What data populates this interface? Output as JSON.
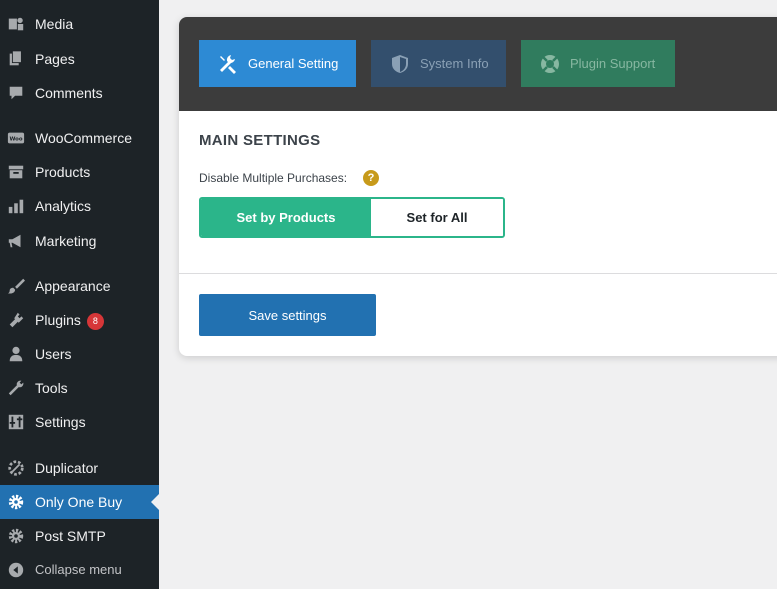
{
  "sidebar": {
    "items": [
      {
        "label": "Media",
        "icon": "media-icon"
      },
      {
        "label": "Pages",
        "icon": "pages-icon"
      },
      {
        "label": "Comments",
        "icon": "comments-icon"
      },
      {
        "label": "WooCommerce",
        "icon": "woocommerce-icon"
      },
      {
        "label": "Products",
        "icon": "products-icon"
      },
      {
        "label": "Analytics",
        "icon": "analytics-icon"
      },
      {
        "label": "Marketing",
        "icon": "megaphone-icon"
      },
      {
        "label": "Appearance",
        "icon": "paintbrush-icon"
      },
      {
        "label": "Plugins",
        "icon": "plugin-icon",
        "badge": "8"
      },
      {
        "label": "Users",
        "icon": "users-icon"
      },
      {
        "label": "Tools",
        "icon": "wrench-icon"
      },
      {
        "label": "Settings",
        "icon": "settings-icon"
      },
      {
        "label": "Duplicator",
        "icon": "duplicator-icon"
      },
      {
        "label": "Only One Buy",
        "icon": "gear-icon",
        "active": true
      },
      {
        "label": "Post SMTP",
        "icon": "gear-icon"
      }
    ],
    "collapse_label": "Collapse menu"
  },
  "tabs": {
    "general": "General Setting",
    "system": "System Info",
    "plugin": "Plugin Support"
  },
  "main": {
    "section_title": "MAIN SETTINGS",
    "field_label": "Disable Multiple Purchases:",
    "help": "?",
    "toggle": {
      "option_on": "Set by Products",
      "option_off": "Set for All",
      "selected": "Set by Products"
    },
    "save_label": "Save settings"
  },
  "colors": {
    "sidebar_bg": "#1d2327",
    "active_bg": "#2271b1",
    "header_bg": "#3c3c3c",
    "tab_general": "#2d8ad4",
    "tab_system": "#334f6d",
    "tab_plugin": "#307c5e",
    "toggle_accent": "#2bb58a",
    "badge": "#d63638",
    "help": "#c79a1a"
  }
}
